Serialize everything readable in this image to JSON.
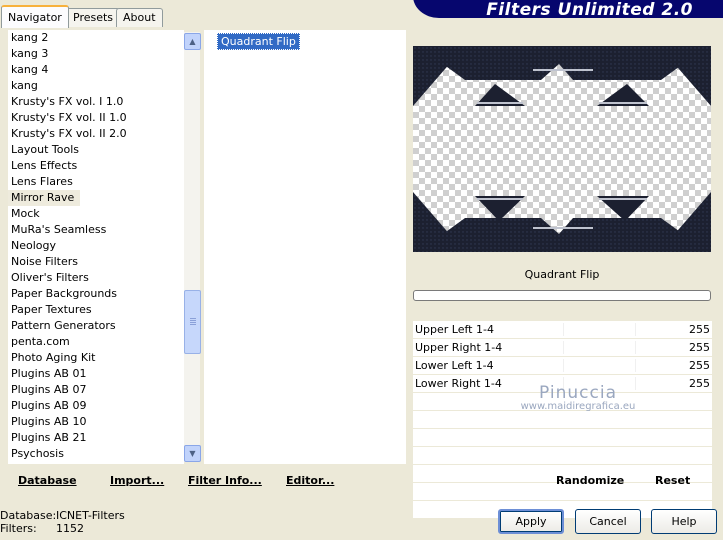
{
  "tabs": [
    {
      "label": "Navigator",
      "active": true
    },
    {
      "label": "Presets",
      "active": false
    },
    {
      "label": "About",
      "active": false
    }
  ],
  "app_title": "Filters Unlimited 2.0",
  "categories": [
    "kang 2",
    "kang 3",
    "kang 4",
    "kang",
    "Krusty's FX vol. I 1.0",
    "Krusty's FX vol. II 1.0",
    "Krusty's FX vol. II 2.0",
    "Layout Tools",
    "Lens Effects",
    "Lens Flares",
    "Mirror Rave",
    "Mock",
    "MuRa's Seamless",
    "Neology",
    "Noise Filters",
    "Oliver's Filters",
    "Paper Backgrounds",
    "Paper Textures",
    "Pattern Generators",
    "penta.com",
    "Photo Aging Kit",
    "Plugins AB 01",
    "Plugins AB 07",
    "Plugins AB 09",
    "Plugins AB 10",
    "Plugins AB 21",
    "Psychosis"
  ],
  "selected_category": "Mirror Rave",
  "filters": [
    "Quadrant Flip"
  ],
  "preview": {
    "filter_name": "Quadrant Flip"
  },
  "params": [
    {
      "label": "Upper Left 1-4",
      "value": "255"
    },
    {
      "label": "Upper Right 1-4",
      "value": "255"
    },
    {
      "label": "Lower Left 1-4",
      "value": "255"
    },
    {
      "label": "Lower Right 1-4",
      "value": "255"
    }
  ],
  "watermark": {
    "name": "Pinuccia",
    "url": "www.maidiregrafica.eu"
  },
  "bottom_links": {
    "database": "Database",
    "import": "Import...",
    "filter_info": "Filter Info...",
    "editor": "Editor...",
    "randomize": "Randomize",
    "reset": "Reset"
  },
  "status": {
    "database_label": "Database:",
    "database_value": "ICNET-Filters",
    "filters_label": "Filters:",
    "filters_value": "1152"
  },
  "buttons": {
    "apply": "Apply",
    "cancel": "Cancel",
    "help": "Help"
  },
  "scroll": {
    "position_fraction": 0.62
  }
}
